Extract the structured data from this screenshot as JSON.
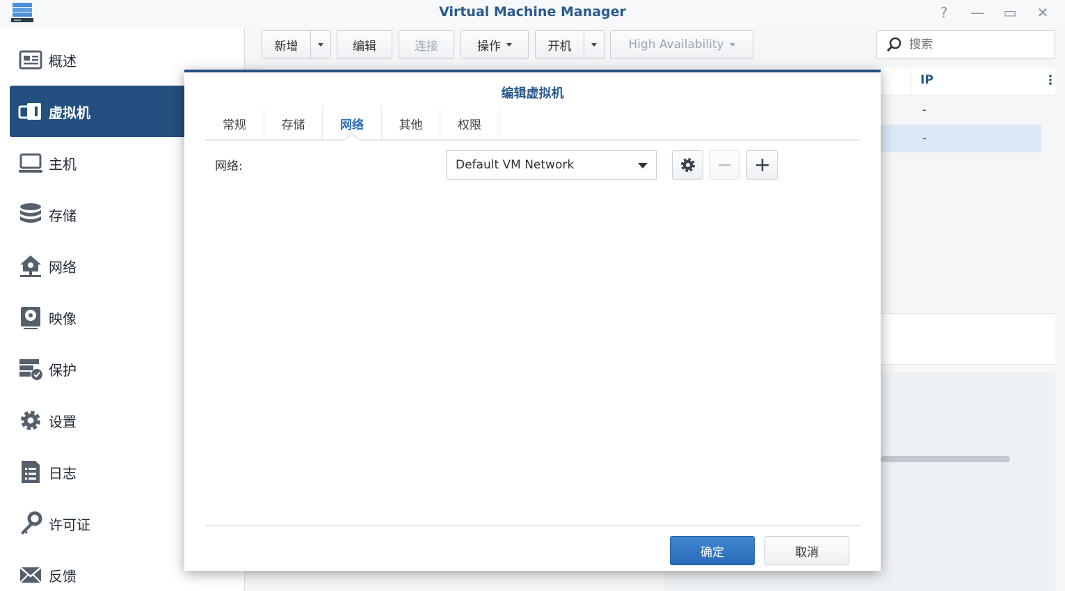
{
  "window": {
    "title": "Virtual Machine Manager",
    "controls": {
      "help": "?",
      "minimize": "—",
      "maximize": "▭",
      "close": "✕"
    }
  },
  "sidebar": {
    "items": [
      {
        "label": "概述",
        "icon": "overview-icon"
      },
      {
        "label": "虚拟机",
        "icon": "virtual-machine-icon",
        "active": true
      },
      {
        "label": "主机",
        "icon": "host-icon"
      },
      {
        "label": "存储",
        "icon": "storage-icon"
      },
      {
        "label": "网络",
        "icon": "network-icon"
      },
      {
        "label": "映像",
        "icon": "image-icon"
      },
      {
        "label": "保护",
        "icon": "protection-icon"
      },
      {
        "label": "设置",
        "icon": "settings-icon"
      },
      {
        "label": "日志",
        "icon": "log-icon"
      },
      {
        "label": "许可证",
        "icon": "license-icon"
      },
      {
        "label": "反馈",
        "icon": "feedback-icon"
      }
    ]
  },
  "toolbar": {
    "new": "新增",
    "edit": "编辑",
    "connect": "连接",
    "action": "操作",
    "power_on": "开机",
    "high_availability": "High Availability",
    "search_placeholder": "搜索"
  },
  "table": {
    "ip_header": "IP",
    "rows": [
      {
        "ip": "-"
      },
      {
        "ip": "-",
        "selected": true
      }
    ]
  },
  "dialog": {
    "title": "编辑虚拟机",
    "tabs": [
      "常规",
      "存储",
      "网络",
      "其他",
      "权限"
    ],
    "active_tab": "网络",
    "network_label": "网络:",
    "network_value": "Default VM Network",
    "ok": "确定",
    "cancel": "取消"
  },
  "colors": {
    "accent": "#24507f",
    "primary_button": "#2a6bb7",
    "title": "#2a5a8c"
  }
}
